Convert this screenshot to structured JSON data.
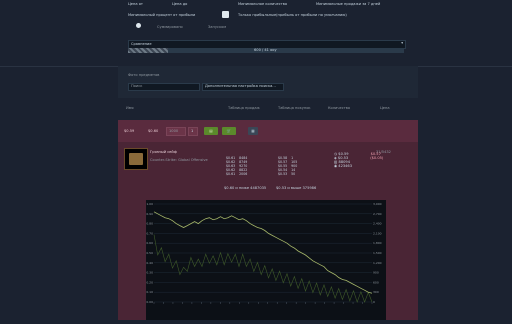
{
  "top": {
    "filters_row1": [
      "Цена от",
      "Цена до",
      "Минимальное количество",
      "Минимальные продажи за 7 дней"
    ],
    "filters_row2": [
      "Минимальный процент от прибыли",
      "Только прибыльные(прибыль от прибыли по умолчанию)"
    ],
    "radio_left": "Суммировано",
    "radio_right": "Запуском",
    "dropdown_label": "Сравнение",
    "progress_text": "600 / 41 ооу"
  },
  "filters": {
    "title": "Фото предметов",
    "search_placeholder": "Поиск",
    "settings_label": "Дополнительная настройка поиска..."
  },
  "columns": [
    "Имя",
    "Таблица продаж",
    "Таблица покупок",
    "Количество",
    "Цена"
  ],
  "toolbar": {
    "price1": "$0.59",
    "price2": "$0.60",
    "qty_placeholder": "1000",
    "step": "1",
    "cart_icon": "cart-icon",
    "chart_icon": "chart-icon"
  },
  "item": {
    "name": "Грязный сейф",
    "subtitle": "Counter-Strike: Global Offensive",
    "sell_table": [
      [
        "$0.61",
        "8484"
      ],
      [
        "$0.62",
        "8749"
      ],
      [
        "$0.63",
        "9270"
      ],
      [
        "$0.62",
        "8822"
      ],
      [
        "$0.61",
        "2006"
      ]
    ],
    "sell_footer": "$0.60 и ниже 4487035",
    "buy_table": [
      [
        "$0.58",
        "1"
      ],
      [
        "$0.57",
        "105"
      ],
      [
        "$0.55",
        "900"
      ],
      [
        "$0.54",
        "14"
      ],
      [
        "$0.53",
        "50"
      ]
    ],
    "buy_footer": "$0.53 и выше 375986",
    "stats": [
      [
        "$0.59",
        "$0.57"
      ],
      [
        "$0.53",
        "($0.05)"
      ],
      [
        "88094",
        ""
      ],
      [
        "423463",
        ""
      ]
    ],
    "top_right": "31/5432"
  },
  "chart_data": {
    "type": "line",
    "ylim": [
      0,
      1.0
    ],
    "y2lim": [
      0,
      3000
    ],
    "yticks": [
      "1.00",
      "0.90",
      "0.80",
      "0.70",
      "0.60",
      "0.50",
      "0.40",
      "0.30",
      "0.20",
      "0.10",
      "0.00"
    ],
    "y2ticks": [
      "3,000",
      "2,700",
      "2,400",
      "2,100",
      "1,800",
      "1,500",
      "1,200",
      "900",
      "600",
      "300",
      "0"
    ],
    "series": [
      {
        "values": [
          0.92,
          0.9,
          0.88,
          0.86,
          0.85,
          0.83,
          0.8,
          0.78,
          0.76,
          0.78,
          0.8,
          0.82,
          0.8,
          0.83,
          0.85,
          0.86,
          0.84,
          0.85,
          0.87,
          0.85,
          0.86,
          0.88,
          0.86,
          0.84,
          0.85,
          0.83,
          0.8,
          0.78,
          0.76,
          0.75,
          0.73,
          0.7,
          0.68,
          0.66,
          0.64,
          0.62,
          0.6,
          0.57,
          0.55,
          0.52,
          0.5,
          0.48,
          0.45,
          0.42,
          0.4,
          0.38,
          0.36,
          0.32,
          0.3,
          0.28,
          0.25,
          0.23,
          0.22,
          0.2,
          0.18,
          0.16,
          0.14,
          0.12,
          0.1,
          0.09
        ]
      },
      {
        "values": [
          1900,
          1600,
          1500,
          1400,
          1300,
          1200,
          1100,
          1000,
          900,
          1100,
          1200,
          1250,
          1150,
          1250,
          1300,
          1350,
          1250,
          1300,
          1350,
          1300,
          1320,
          1380,
          1300,
          1250,
          1300,
          1250,
          1150,
          1100,
          1050,
          1000,
          950,
          900,
          850,
          820,
          780,
          750,
          700,
          650,
          620,
          580,
          550,
          500,
          480,
          450,
          420,
          380,
          360,
          330,
          300,
          280,
          250,
          240,
          220,
          200,
          180,
          160,
          150,
          140,
          130,
          120
        ]
      }
    ]
  }
}
